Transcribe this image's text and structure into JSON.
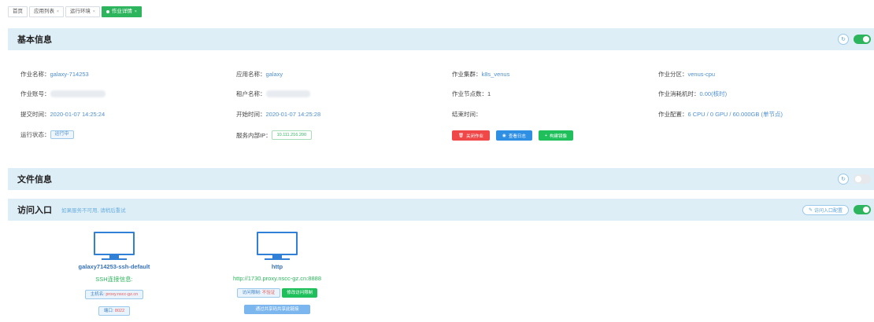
{
  "tabs": [
    {
      "label": "首页",
      "active": false,
      "has_chevron": false
    },
    {
      "label": "应用列表",
      "active": false,
      "has_chevron": true
    },
    {
      "label": "运行环境",
      "active": false,
      "has_chevron": true
    },
    {
      "label": "作业详情",
      "active": true,
      "has_chevron": true
    }
  ],
  "basic": {
    "title": "基本信息",
    "fields": {
      "job_name_label": "作业名称：",
      "job_name": "galaxy-714253",
      "app_name_label": "应用名称：",
      "app_name": "galaxy",
      "cluster_label": "作业集群：",
      "cluster": "k8s_venus",
      "partition_label": "作业分区：",
      "partition": "venus-cpu",
      "account_label": "作业账号：",
      "tenant_label": "租户名称：",
      "nodes_label": "作业节点数：",
      "nodes": "1",
      "elapsed_label": "作业消耗机时：",
      "elapsed": "0.00(核时)",
      "submit_label": "提交时间：",
      "submit_time": "2020-01-07 14:25:24",
      "start_label": "开始时间：",
      "start_time": "2020-01-07 14:25:28",
      "end_label": "结束时间：",
      "config_label": "作业配置：",
      "config": "6 CPU / 0 GPU / 60.000GB (单节点)",
      "status_label": "运行状态：",
      "status": "运行中",
      "ip_label": "服务内部IP：",
      "ip": "10.111.216.200"
    },
    "actions": {
      "close": "关闭作业",
      "log": "查看日志",
      "image": "构建镜像"
    }
  },
  "files": {
    "title": "文件信息"
  },
  "access": {
    "title": "访问入口",
    "hint": "如果服务不可用, 请稍后重试",
    "config_button": "访问入口配置",
    "entries": [
      {
        "name": "galaxy714253-ssh-default",
        "sub": "SSH连接信息:",
        "host_label": "主机名:",
        "host": "proxy.nscc-gz.cn",
        "port_label": "端口:",
        "port": "8022"
      },
      {
        "name": "http",
        "sub": "http://1730.proxy.nscc-gz.cn:8888",
        "restrict_label": "访问限制:",
        "restrict_value": "不验证",
        "modify_button": "修改访问限制",
        "share_button": "通过共享码共享此链接"
      }
    ]
  },
  "colors": {
    "accent_green": "#2db55d",
    "link_blue": "#4f8fd1",
    "section_bg": "#deeef7",
    "danger_red": "#f04848"
  }
}
